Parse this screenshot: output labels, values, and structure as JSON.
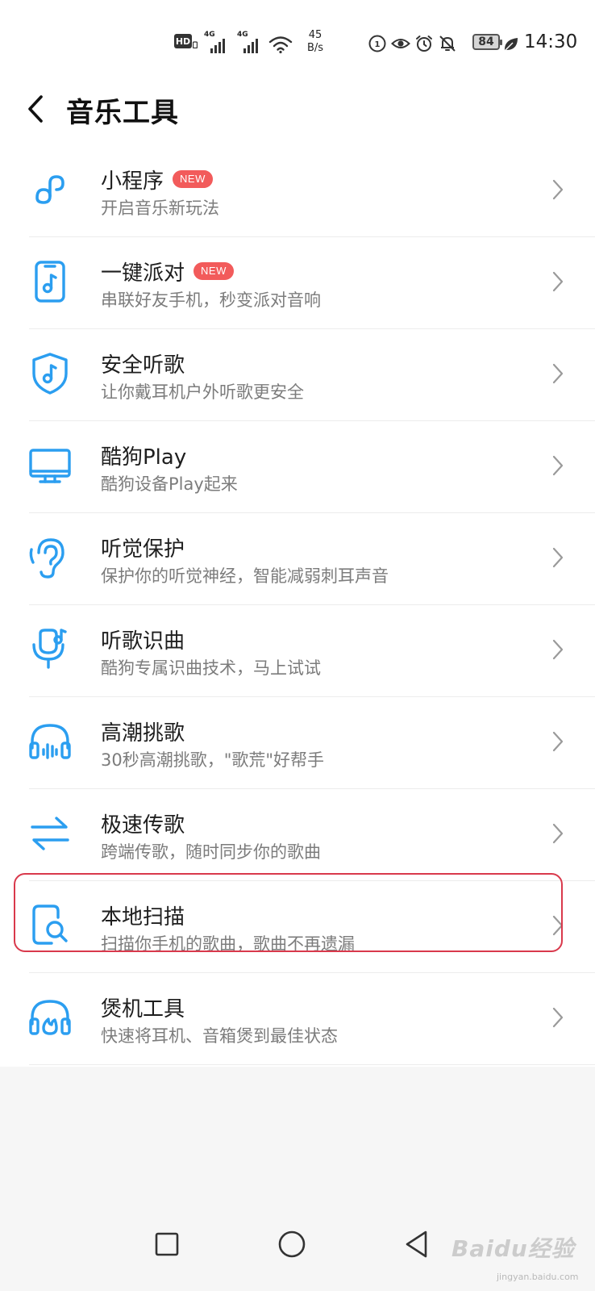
{
  "status_bar": {
    "hd_label": "HD",
    "network_tag_1": "4G",
    "network_tag_2": "4G",
    "speed_value": "45",
    "speed_unit": "B/s",
    "battery": "84",
    "time": "14:30"
  },
  "header": {
    "title": "音乐工具"
  },
  "colors": {
    "accent_blue": "#2b9ef0",
    "badge_red": "#f25b5b",
    "highlight_red": "#d9394c"
  },
  "tools": [
    {
      "title": "小程序",
      "subtitle": "开启音乐新玩法",
      "badge": "NEW",
      "icon": "mini-program-icon"
    },
    {
      "title": "一键派对",
      "subtitle": "串联好友手机，秒变派对音响",
      "badge": "NEW",
      "icon": "phone-music-icon"
    },
    {
      "title": "安全听歌",
      "subtitle": "让你戴耳机户外听歌更安全",
      "badge": "",
      "icon": "shield-music-icon"
    },
    {
      "title": "酷狗Play",
      "subtitle": "酷狗设备Play起来",
      "badge": "",
      "icon": "monitor-icon"
    },
    {
      "title": "听觉保护",
      "subtitle": "保护你的听觉神经，智能减弱刺耳声音",
      "badge": "",
      "icon": "ear-icon"
    },
    {
      "title": "听歌识曲",
      "subtitle": "酷狗专属识曲技术，马上试试",
      "badge": "",
      "icon": "mic-music-icon"
    },
    {
      "title": "高潮挑歌",
      "subtitle": "30秒高潮挑歌，\"歌荒\"好帮手",
      "badge": "",
      "icon": "headphones-wave-icon"
    },
    {
      "title": "极速传歌",
      "subtitle": "跨端传歌，随时同步你的歌曲",
      "badge": "",
      "icon": "transfer-arrows-icon"
    },
    {
      "title": "本地扫描",
      "subtitle": "扫描你手机的歌曲，歌曲不再遗漏",
      "badge": "",
      "icon": "phone-search-icon"
    },
    {
      "title": "煲机工具",
      "subtitle": "快速将耳机、音箱煲到最佳状态",
      "badge": "",
      "icon": "headphones-flame-icon"
    }
  ],
  "watermark": {
    "text": "Baidu经验",
    "subtext": "jingyan.baidu.com"
  }
}
